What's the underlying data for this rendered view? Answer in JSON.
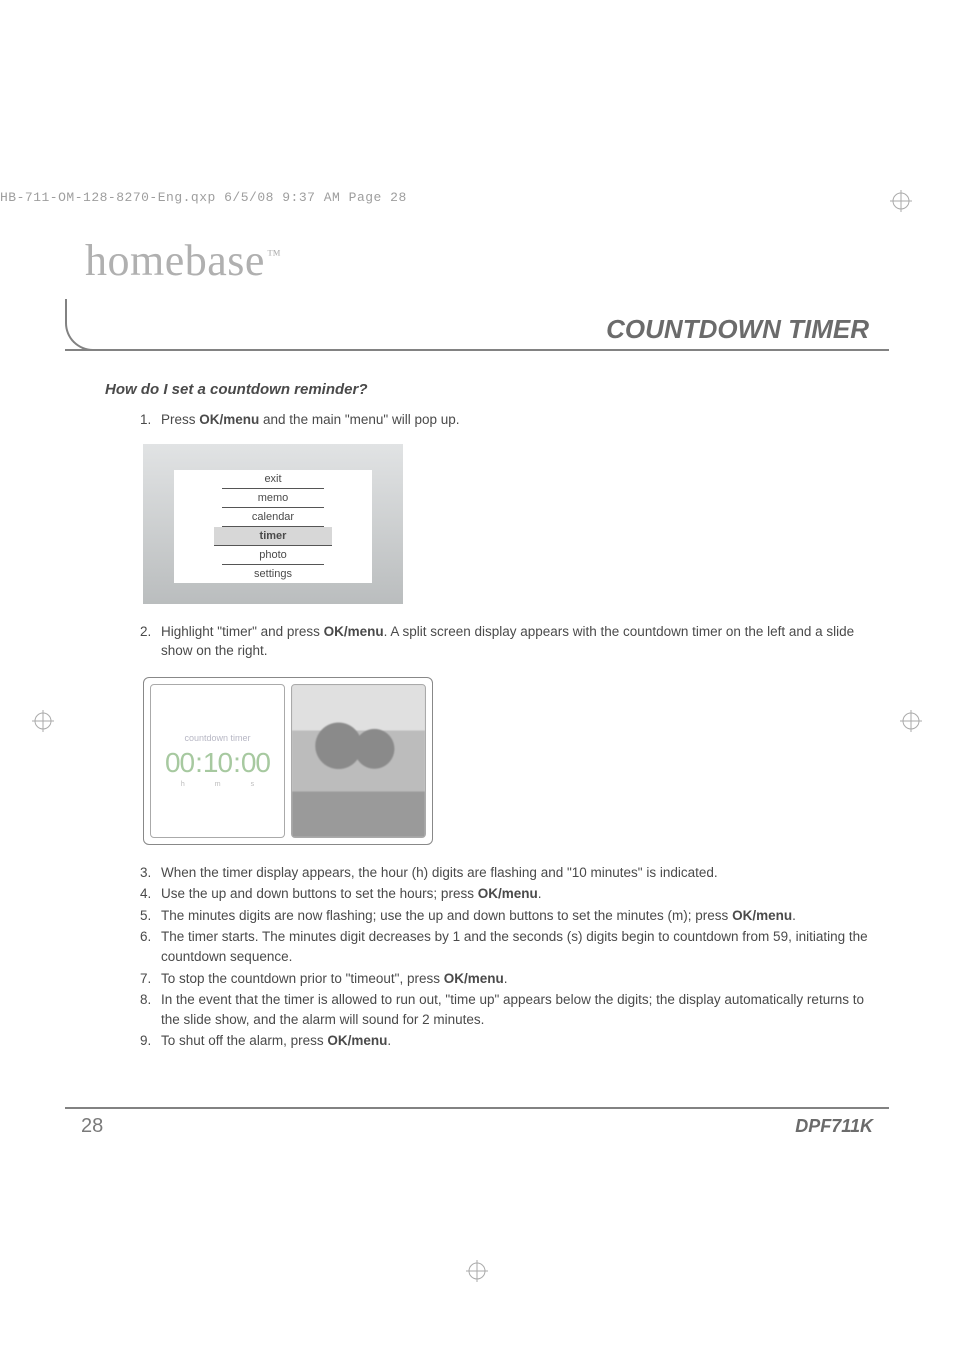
{
  "meta": {
    "crop_line": "HB-711-OM-128-8270-Eng.qxp  6/5/08  9:37 AM  Page 28"
  },
  "header": {
    "logo_main": "home",
    "logo_light": "base",
    "tm": "™",
    "section_title": "COUNTDOWN TIMER"
  },
  "subhead": "How do I set a countdown reminder?",
  "steps": {
    "s1_pre": "Press ",
    "s1_bold": "OK/menu",
    "s1_post": " and the main \"menu\" will pop up.",
    "s2_pre": "Highlight \"timer\" and press ",
    "s2_bold": "OK/menu",
    "s2_post": ". A split screen display appears with the countdown timer on the left and a slide show on the right.",
    "s3": "When the timer display appears, the hour (h) digits are flashing and \"10 minutes\" is indicated.",
    "s4_pre": "Use the up and down buttons to set the hours; press ",
    "s4_bold": "OK/menu",
    "s4_post": ".",
    "s5_pre": "The minutes digits are now flashing; use the up and down buttons to set the minutes (m); press ",
    "s5_bold": "OK/menu",
    "s5_post": ".",
    "s6": "The timer starts. The minutes digit decreases by 1 and the seconds (s) digits begin to countdown from 59, initiating the countdown sequence.",
    "s7_pre": "To stop the countdown prior to \"timeout\", press ",
    "s7_bold": "OK/menu",
    "s7_post": ".",
    "s8": "In the event that the timer is allowed to run out, \"time up\" appears below the digits; the display automatically returns to the slide show, and the alarm will sound for 2 minutes.",
    "s9_pre": "To shut off the alarm, press ",
    "s9_bold": "OK/menu",
    "s9_post": "."
  },
  "menu": {
    "items": [
      "exit",
      "memo",
      "calendar",
      "timer",
      "photo",
      "settings"
    ],
    "selected_index": 3
  },
  "countdown": {
    "label": "countdown timer",
    "hh": "00",
    "mm": "10",
    "ss": "00",
    "u_h": "h",
    "u_m": "m",
    "u_s": "s"
  },
  "footer": {
    "page": "28",
    "model": "DPF711K"
  }
}
